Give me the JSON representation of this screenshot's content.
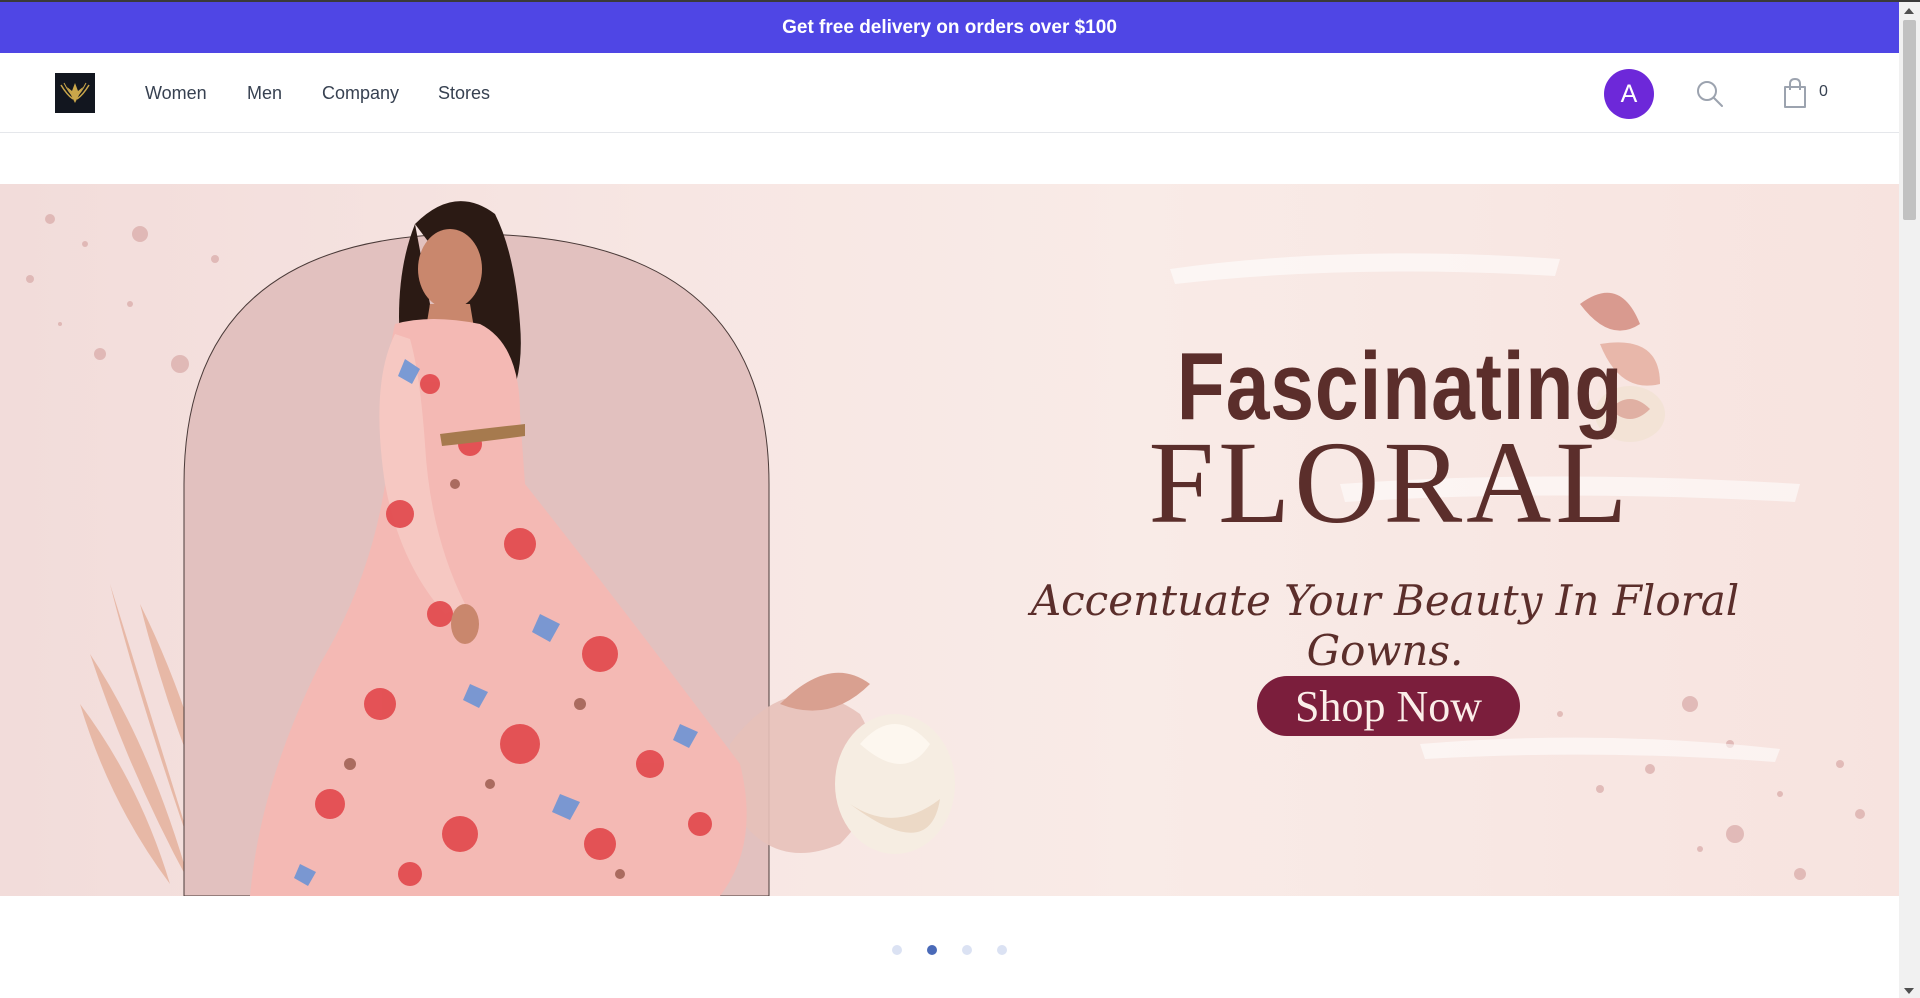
{
  "announcement": {
    "text": "Get free delivery on orders over $100"
  },
  "navbar": {
    "logo_icon": "phoenix-logo-icon",
    "links": [
      "Women",
      "Men",
      "Company",
      "Stores"
    ],
    "avatar_letter": "A",
    "search_icon": "search-icon",
    "cart_icon": "shopping-bag-icon",
    "cart_count": "0"
  },
  "hero": {
    "title_line1": "Fascinating",
    "title_line2": "FLORAL",
    "tagline": "Accentuate Your Beauty In Floral Gowns.",
    "cta_label": "Shop Now",
    "colors": {
      "title": "#5b2e2b",
      "cta_bg": "#7b1e3c",
      "arch": "#e2c1bf"
    }
  },
  "carousel": {
    "slide_count": 4,
    "active_index": 1
  },
  "colors": {
    "announcement_bg": "#4f46e5",
    "avatar_bg": "#6d28d9",
    "dot_active": "#4a6ab8",
    "dot_inactive": "#dbe2f3"
  }
}
